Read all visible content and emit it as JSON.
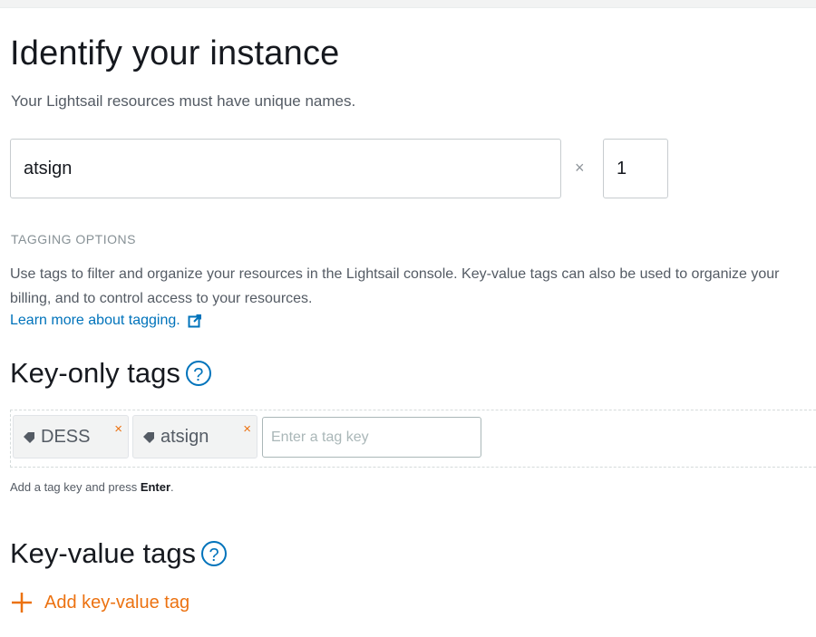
{
  "identify": {
    "title": "Identify your instance",
    "subtitle": "Your Lightsail resources must have unique names.",
    "name_value": "atsign",
    "times": "×",
    "quantity_value": "1"
  },
  "tagging": {
    "section_label": "TAGGING OPTIONS",
    "description": "Use tags to filter and organize your resources in the Lightsail console. Key-value tags can also be used to organize your billing, and to control access to your resources.",
    "learn_more": "Learn more about tagging.",
    "key_only": {
      "title": "Key-only tags",
      "help": "?",
      "tags": [
        {
          "label": "DESS",
          "remove": "×"
        },
        {
          "label": "atsign",
          "remove": "×"
        }
      ],
      "input_placeholder": "Enter a tag key",
      "hint_prefix": "Add a tag key and press ",
      "hint_key": "Enter",
      "hint_suffix": "."
    },
    "key_value": {
      "title": "Key-value tags",
      "help": "?",
      "add_label": "Add key-value tag"
    }
  },
  "colors": {
    "accent_orange": "#ec7211",
    "link_blue": "#0073bb"
  },
  "icons": [
    "external-link-icon",
    "help-icon",
    "tag-icon",
    "remove-icon",
    "plus-icon"
  ]
}
